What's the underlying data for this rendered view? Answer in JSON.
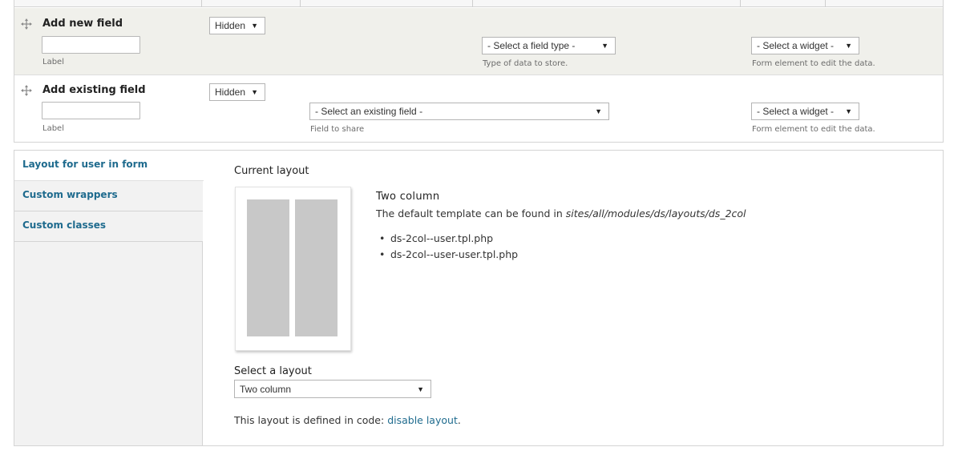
{
  "fields_table": {
    "add_new": {
      "title": "Add new field",
      "label_hint": "Label",
      "label_value": "",
      "region_select": "Hidden",
      "type_select": "- Select a field type -",
      "type_hint": "Type of data to store.",
      "widget_select": "- Select a widget -",
      "widget_hint": "Form element to edit the data."
    },
    "add_existing": {
      "title": "Add existing field",
      "label_hint": "Label",
      "label_value": "",
      "region_select": "Hidden",
      "field_select": "- Select an existing field -",
      "field_hint": "Field to share",
      "widget_select": "- Select a widget -",
      "widget_hint": "Form element to edit the data."
    }
  },
  "vertical_tabs": [
    {
      "label": "Layout for user in form",
      "active": true
    },
    {
      "label": "Custom wrappers",
      "active": false
    },
    {
      "label": "Custom classes",
      "active": false
    }
  ],
  "layout_panel": {
    "current_layout_label": "Current layout",
    "layout_name": "Two column",
    "template_text": "The default template can be found in",
    "template_path": "sites/all/modules/ds/layouts/ds_2col",
    "template_files": [
      "ds-2col--user.tpl.php",
      "ds-2col--user-user.tpl.php"
    ],
    "select_label": "Select a layout",
    "select_value": "Two column",
    "defined_text": "This layout is defined in code:",
    "disable_link": "disable layout",
    "trailing_period": "."
  },
  "icons": {
    "drag_handle": "move-arrows-icon",
    "dropdown": "triangle-down-icon"
  },
  "colors": {
    "link": "#1f6b8e",
    "row_highlight": "#f0f0eb",
    "tab_background": "#f2f2f2",
    "preview_column": "#c8c8c8"
  }
}
